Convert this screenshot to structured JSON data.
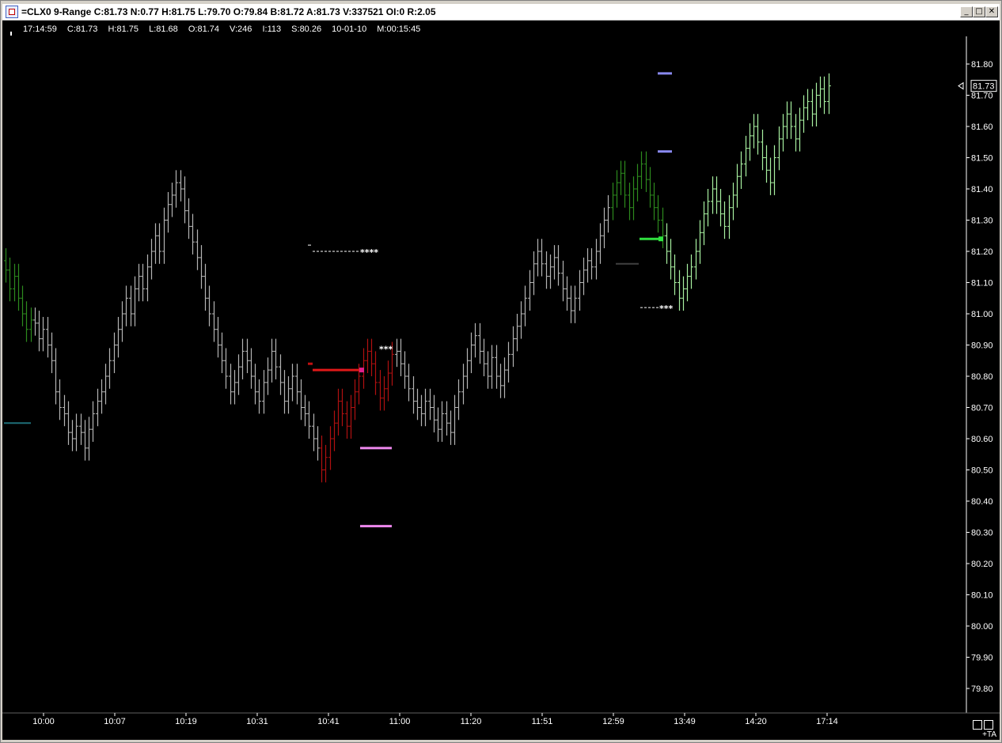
{
  "window": {
    "title": "=CLX0 9-Range C:81.73 N:0.77 H:81.75 L:79.70 O:79.84 B:81.72 A:81.73 V:337521 OI:0 R:2.05",
    "minimize_glyph": "_",
    "maximize_glyph": "□",
    "close_glyph": "✕"
  },
  "info_line": {
    "time": "17:14:59",
    "close": "C:81.73",
    "high": "H:81.75",
    "low": "L:81.68",
    "open": "O:81.74",
    "volume": "V:246",
    "index": "I:113",
    "settle": "S:80.26",
    "date": "10-01-10",
    "elapsed": "M:00:15:45"
  },
  "corner": {
    "ta_label": "+TA"
  },
  "colors": {
    "background": "#000000",
    "neutral_bar": "#b4b4b4",
    "dark_green_bar": "#2d8a1e",
    "light_green_bar": "#a8f0a0",
    "red_bar": "#b01010",
    "last_price_tag": "#ffffff"
  },
  "chart_data": {
    "type": "ohlc",
    "symbol": "CLX0",
    "bar_type": "9-Range",
    "y_axis_labels": [
      "81.80",
      "81.70",
      "81.60",
      "81.50",
      "81.40",
      "81.30",
      "81.20",
      "81.10",
      "81.00",
      "80.90",
      "80.80",
      "80.70",
      "80.60",
      "80.50",
      "80.40",
      "80.30",
      "80.20",
      "80.10",
      "80.00",
      "79.90",
      "79.80"
    ],
    "y_range": [
      79.75,
      81.9
    ],
    "last_price_label": "81.73",
    "x_axis_labels": [
      "10:00",
      "10:07",
      "10:19",
      "10:31",
      "10:41",
      "11:00",
      "11:20",
      "11:51",
      "12:59",
      "13:49",
      "14:20",
      "17:14"
    ],
    "series": [
      {
        "name": "",
        "color_key": "dark_green_bar",
        "closes": [
          81.14,
          81.08,
          81.12,
          81.05,
          81.0,
          80.95,
          80.98
        ]
      },
      {
        "name": "",
        "color_key": "neutral_bar",
        "closes": [
          80.97,
          80.92,
          80.95,
          80.9,
          80.85,
          80.75,
          80.7,
          80.68,
          80.62,
          80.6,
          80.64,
          80.62,
          80.57,
          80.63,
          80.68,
          80.72,
          80.75,
          80.8,
          80.85,
          80.9,
          80.95,
          81.0,
          81.05,
          81.0,
          81.08,
          81.12,
          81.08,
          81.15,
          81.2,
          81.25,
          81.2,
          81.3,
          81.35,
          81.38,
          81.42,
          81.4,
          81.33,
          81.28,
          81.23,
          81.18,
          81.12,
          81.05,
          81.0,
          80.95,
          80.9,
          80.85,
          80.8,
          80.75,
          80.78,
          80.83,
          80.88,
          80.85,
          80.8,
          80.75,
          80.72,
          80.78,
          80.82,
          80.88,
          80.83,
          80.78,
          80.72,
          80.76,
          80.8,
          80.75,
          80.7,
          80.68,
          80.64,
          80.6,
          80.57
        ]
      },
      {
        "name": "",
        "color_key": "red_bar",
        "closes": [
          80.5,
          80.54,
          80.6,
          80.65,
          80.72,
          80.68,
          80.64,
          80.7,
          80.75,
          80.8,
          80.85,
          80.88,
          80.84,
          80.78,
          80.73,
          80.76,
          80.81,
          80.87
        ]
      },
      {
        "name": "",
        "color_key": "neutral_bar",
        "closes": [
          80.88,
          80.84,
          80.8,
          80.76,
          80.72,
          80.7,
          80.68,
          80.72,
          80.7,
          80.66,
          80.63,
          80.68,
          80.65,
          80.62,
          80.7,
          80.75,
          80.8,
          80.85,
          80.9,
          80.93,
          80.88,
          80.84,
          80.8,
          80.86,
          80.8,
          80.77,
          80.82,
          80.87,
          80.92,
          80.96,
          81.0,
          81.05,
          81.1,
          81.16,
          81.2,
          81.16,
          81.12,
          81.15,
          81.18,
          81.13,
          81.08,
          81.05,
          81.01,
          81.05,
          81.1,
          81.14,
          81.17,
          81.15,
          81.2,
          81.25,
          81.3,
          81.34
        ]
      },
      {
        "name": "",
        "color_key": "dark_green_bar",
        "closes": [
          81.38,
          81.42,
          81.45,
          81.38,
          81.34,
          81.4,
          81.44,
          81.48,
          81.43,
          81.38,
          81.34,
          81.3,
          81.25
        ]
      },
      {
        "name": "",
        "color_key": "light_green_bar",
        "closes": [
          81.2,
          81.15,
          81.1,
          81.05,
          81.08,
          81.12,
          81.15,
          81.2,
          81.26,
          81.32,
          81.36,
          81.4,
          81.36,
          81.32,
          81.28,
          81.34,
          81.38,
          81.44,
          81.48,
          81.53,
          81.57,
          81.6,
          81.55,
          81.5,
          81.46,
          81.42,
          81.5,
          81.56,
          81.6,
          81.64,
          81.6,
          81.56,
          81.62,
          81.66,
          81.68,
          81.64,
          81.7,
          81.72,
          81.68,
          81.73
        ]
      }
    ],
    "annotations": [
      {
        "kind": "stars",
        "text": "****",
        "price": 81.2
      },
      {
        "kind": "stars",
        "text": "***",
        "price": 80.89
      },
      {
        "kind": "stars",
        "text": "***",
        "price": 81.02
      }
    ]
  }
}
